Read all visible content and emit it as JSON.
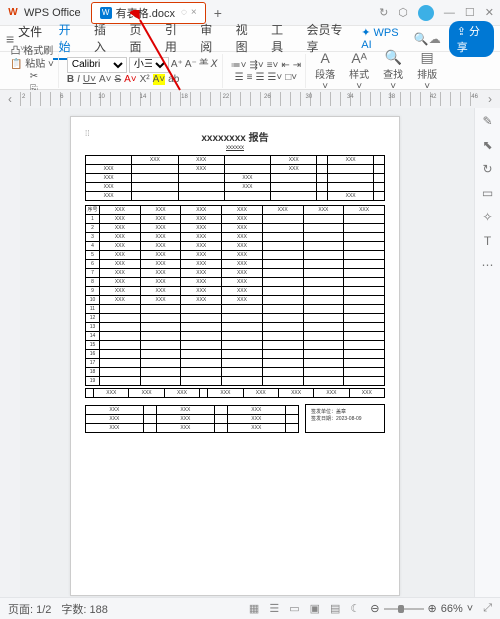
{
  "app": {
    "name": "WPS Office"
  },
  "tab": {
    "doc_name": "有表格.docx",
    "bubble": "◌",
    "close": "×",
    "plus": "+"
  },
  "menubar": {
    "file": "文件",
    "items": [
      "开始",
      "插入",
      "页面",
      "引用",
      "审阅",
      "视图",
      "工具",
      "会员专享"
    ],
    "active_index": 0,
    "ai": "WPS AI"
  },
  "share": "分享",
  "ribbon": {
    "formatbrush": "格式刷",
    "paste": "粘贴",
    "font_name": "Calibri",
    "font_size": "小三",
    "row1": [
      "A⁺",
      "A⁻",
      "⺷",
      "𝘟"
    ],
    "row2_labels": [
      "B",
      "I",
      "U",
      "A",
      "S",
      "A",
      "X²",
      "A",
      "ab"
    ],
    "para_btn": "段落",
    "style_btn": "样式",
    "find_btn": "查找",
    "sort_btn": "排版"
  },
  "ruler_nav": {
    "prev": "‹",
    "next": "›"
  },
  "document": {
    "title": "xxxxxxxx 报告",
    "subtitle": "xxxxxx",
    "placeholder": "XXX",
    "header_rows": [
      [
        "",
        "XXX",
        "XXX",
        "",
        "XXX",
        "",
        "XXX",
        ""
      ],
      [
        "XXX",
        "",
        "XXX",
        "",
        "XXX",
        "",
        "",
        ""
      ],
      [
        "XXX",
        "",
        "",
        "XXX",
        "",
        "",
        "",
        ""
      ],
      [
        "XXX",
        "",
        "",
        "XXX",
        "",
        "",
        "",
        ""
      ],
      [
        "XXX",
        "",
        "",
        "",
        "",
        "",
        "XXX",
        ""
      ]
    ],
    "table_header": [
      "序号",
      "XXX",
      "XXX",
      "XXX",
      "XXX",
      "XXX",
      "XXX",
      "XXX"
    ],
    "rows": 19,
    "filled_rows": [
      1,
      2,
      3,
      4,
      5,
      6,
      7,
      8,
      9,
      10
    ],
    "footer_row": [
      "",
      "XXX",
      "XXX",
      "XXX",
      "",
      "XXX",
      "XXX",
      "XXX",
      "XXX",
      "XXX"
    ],
    "sig_rows": [
      [
        "XXX",
        "",
        "XXX",
        "",
        "XXX",
        ""
      ],
      [
        "XXX",
        "",
        "XXX",
        "",
        "XXX",
        ""
      ],
      [
        "XXX",
        "",
        "XXX",
        "",
        "XXX",
        ""
      ]
    ],
    "sig_unit": "签发单位：盖章",
    "sig_date_label": "签发日期：",
    "sig_date": "2023-08-09"
  },
  "rsidebar_icons": [
    "pencil-icon",
    "pointer-icon",
    "loop-icon",
    "page-icon",
    "star-icon",
    "tee-icon",
    "dots-icon"
  ],
  "status": {
    "page": "页面: 1/2",
    "words": "字数: 188",
    "zoom": "66%"
  }
}
